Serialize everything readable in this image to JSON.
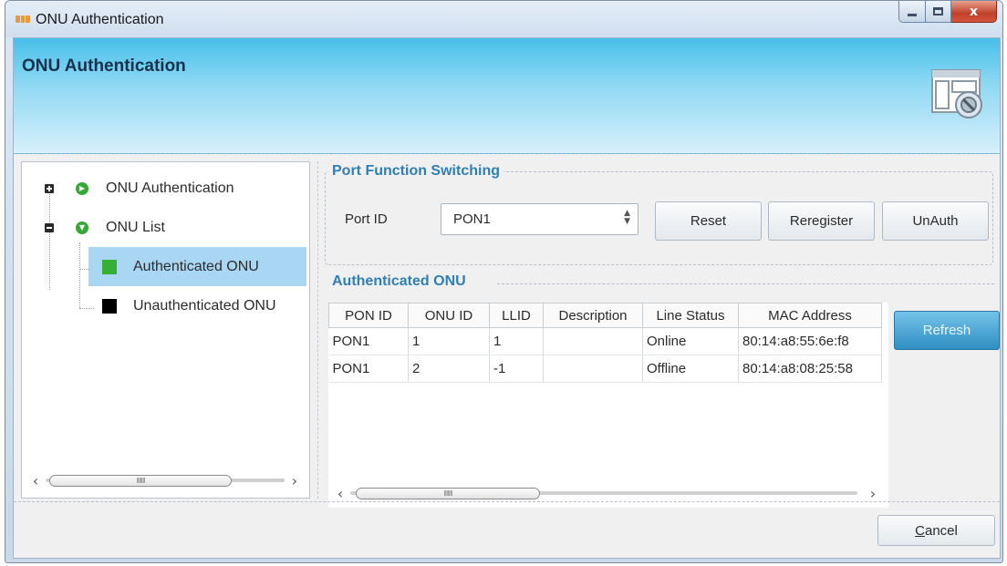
{
  "window": {
    "title": "ONU Authentication",
    "close_glyph": "x"
  },
  "header": {
    "title": "ONU Authentication",
    "icon": "settings-window-icon"
  },
  "tree": {
    "nodes": [
      {
        "label": "ONU Authentication",
        "expander": "plus",
        "icon": "play-circle-icon",
        "color": "#35a935"
      },
      {
        "label": "ONU List",
        "expander": "minus",
        "icon": "chevron-down-circle-icon",
        "color": "#35a935"
      }
    ],
    "children": [
      {
        "label": "Authenticated ONU",
        "color": "#35b035",
        "selected": true
      },
      {
        "label": "Unauthenticated ONU",
        "color": "#000000",
        "selected": false
      }
    ],
    "scroll_glyph": "IIIIIII"
  },
  "port_group": {
    "title": "Port Function Switching",
    "port_label": "Port ID",
    "port_value": "PON1",
    "reset_label": "Reset",
    "reregister_label": "Reregister",
    "unauth_label": "UnAuth"
  },
  "onu_section": {
    "title": "Authenticated ONU",
    "refresh_label": "Refresh"
  },
  "table": {
    "columns": [
      "PON ID",
      "ONU ID",
      "LLID",
      "Description",
      "Line Status",
      "MAC Address"
    ],
    "rows": [
      [
        "PON1",
        "1",
        "1",
        "",
        "Online",
        "80:14:a8:55:6e:f8"
      ],
      [
        "PON1",
        "2",
        "-1",
        "",
        "Offline",
        "80:14:a8:08:25:58"
      ]
    ],
    "scroll_glyph": "IIIIIII"
  },
  "footer": {
    "cancel_label_first": "C",
    "cancel_label_rest": "ancel"
  },
  "colors": {
    "header_gradient_top": "#46bfea",
    "accent_title": "#2f7fb5",
    "selection": "#a8d6f3",
    "refresh_button": "#2f8fc2"
  }
}
